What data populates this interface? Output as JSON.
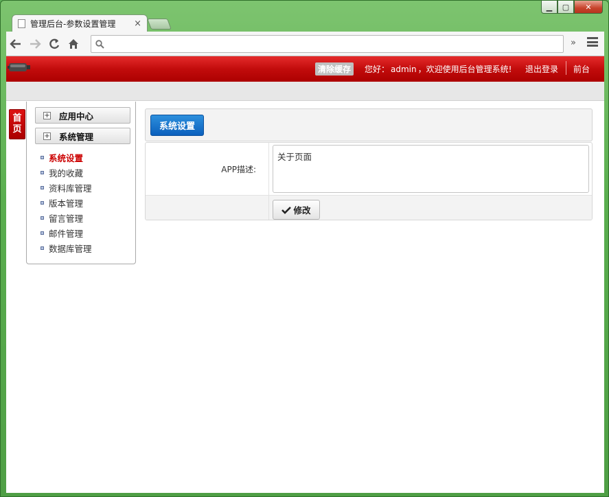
{
  "browser": {
    "tab_title": "管理后台-参数设置管理",
    "tab_close": "×",
    "url": "",
    "more_chevron": "»",
    "icons": {
      "back": "back-arrow-icon",
      "forward": "forward-arrow-icon",
      "reload": "reload-icon",
      "home": "home-icon",
      "search": "search-icon",
      "menu": "hamburger-menu-icon"
    }
  },
  "window_controls": {
    "minimize": "▁",
    "maximize": "▢",
    "close": "✕"
  },
  "header": {
    "clear_cache": "清除缓存",
    "welcome_prefix": "您好：",
    "username": "admin",
    "welcome_suffix": "，欢迎使用后台管理系统!",
    "logout": "退出登录",
    "front": "前台",
    "colors": {
      "bar": "#c20c0c"
    }
  },
  "home_tab": {
    "line1": "首",
    "line2": "页"
  },
  "sidebar": {
    "groups": [
      {
        "label": "应用中心",
        "toggle": "+"
      },
      {
        "label": "系统管理",
        "toggle": "+"
      }
    ],
    "items": [
      {
        "label": "系统设置",
        "active": true
      },
      {
        "label": "我的收藏"
      },
      {
        "label": "资料库管理"
      },
      {
        "label": "版本管理"
      },
      {
        "label": "留言管理"
      },
      {
        "label": "邮件管理"
      },
      {
        "label": "数据库管理"
      }
    ]
  },
  "content": {
    "section_button": "系统设置",
    "form": {
      "field_label": "APP描述:",
      "field_value": "关于页面",
      "submit_label": "修改",
      "submit_icon": "check-icon"
    }
  }
}
